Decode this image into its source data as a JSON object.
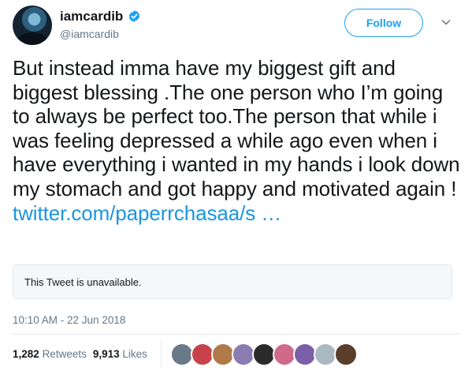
{
  "author": {
    "display_name": "iamcardib",
    "handle": "@iamcardib",
    "verified": true,
    "verified_color": "#1da1f2"
  },
  "follow_button": {
    "label": "Follow"
  },
  "menu": {
    "icon": "chevron-down-icon"
  },
  "tweet": {
    "text": "But instead imma have my biggest gift and biggest blessing .The one person who I’m going to always be perfect too.The person that while i was feeling depressed a while ago even when i have everything i wanted in my hands i look down my stomach and got happy and motivated again !",
    "link": "twitter.com/paperrchasaa/s …",
    "link_color": "#1b95e0"
  },
  "quoted_tweet": {
    "message": "This Tweet is unavailable."
  },
  "timestamp": "10:10 AM - 22 Jun 2018",
  "stats": {
    "retweets_count": "1,282",
    "retweets_label": "Retweets",
    "likes_count": "9,913",
    "likes_label": "Likes"
  },
  "liker_avatars": [
    {
      "color": "#6b7a88"
    },
    {
      "color": "#c7424b"
    },
    {
      "color": "#b07a4a"
    },
    {
      "color": "#8a7bb0"
    },
    {
      "color": "#2a2a2a"
    },
    {
      "color": "#d06a8a"
    },
    {
      "color": "#7b5fa8"
    },
    {
      "color": "#aab8c2"
    },
    {
      "color": "#5a3d2a"
    }
  ]
}
